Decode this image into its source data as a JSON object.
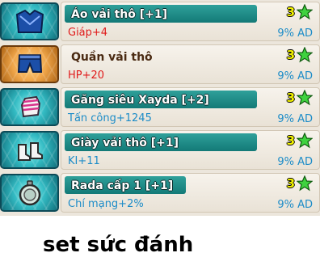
{
  "items": [
    {
      "name": "Áo vải thô [+1]",
      "stat": "Giáp+4",
      "stat_color": "#e01a1a",
      "level": "3",
      "ad": "9% AD",
      "icon": "shirt-icon",
      "frame": "teal"
    },
    {
      "name": "Quần vải thô",
      "stat": "HP+20",
      "stat_color": "#e01a1a",
      "level": "3",
      "ad": "9% AD",
      "icon": "pants-icon",
      "frame": "orange"
    },
    {
      "name": "Găng siêu Xayda [+2]",
      "stat": "Tấn công+1245",
      "stat_color": "#1c8cc8",
      "level": "3",
      "ad": "9% AD",
      "icon": "glove-icon",
      "frame": "teal"
    },
    {
      "name": "Giày vải thô [+1]",
      "stat": "KI+11",
      "stat_color": "#1c8cc8",
      "level": "3",
      "ad": "9% AD",
      "icon": "boots-icon",
      "frame": "teal"
    },
    {
      "name": "Rada cấp 1 [+1]",
      "stat": "Chí mạng+2%",
      "stat_color": "#1c8cc8",
      "level": "3",
      "ad": "9% AD",
      "icon": "radar-icon",
      "frame": "teal"
    }
  ],
  "caption": "set sức đánh"
}
